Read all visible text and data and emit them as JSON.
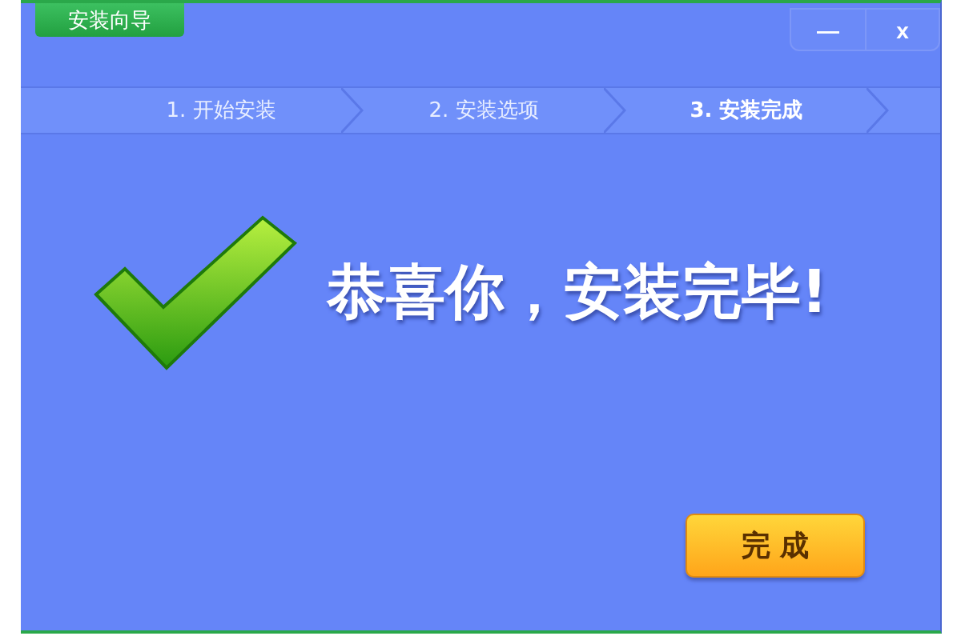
{
  "window": {
    "title": "安装向导",
    "controls": [
      "—",
      "x"
    ]
  },
  "steps": [
    {
      "label": "1. 开始安装",
      "selected": false
    },
    {
      "label": "2. 安装选项",
      "selected": false
    },
    {
      "label": "3. 安装完成",
      "selected": true
    }
  ],
  "message": "恭喜你，安装完毕!",
  "buttons": [
    "完 成"
  ]
}
